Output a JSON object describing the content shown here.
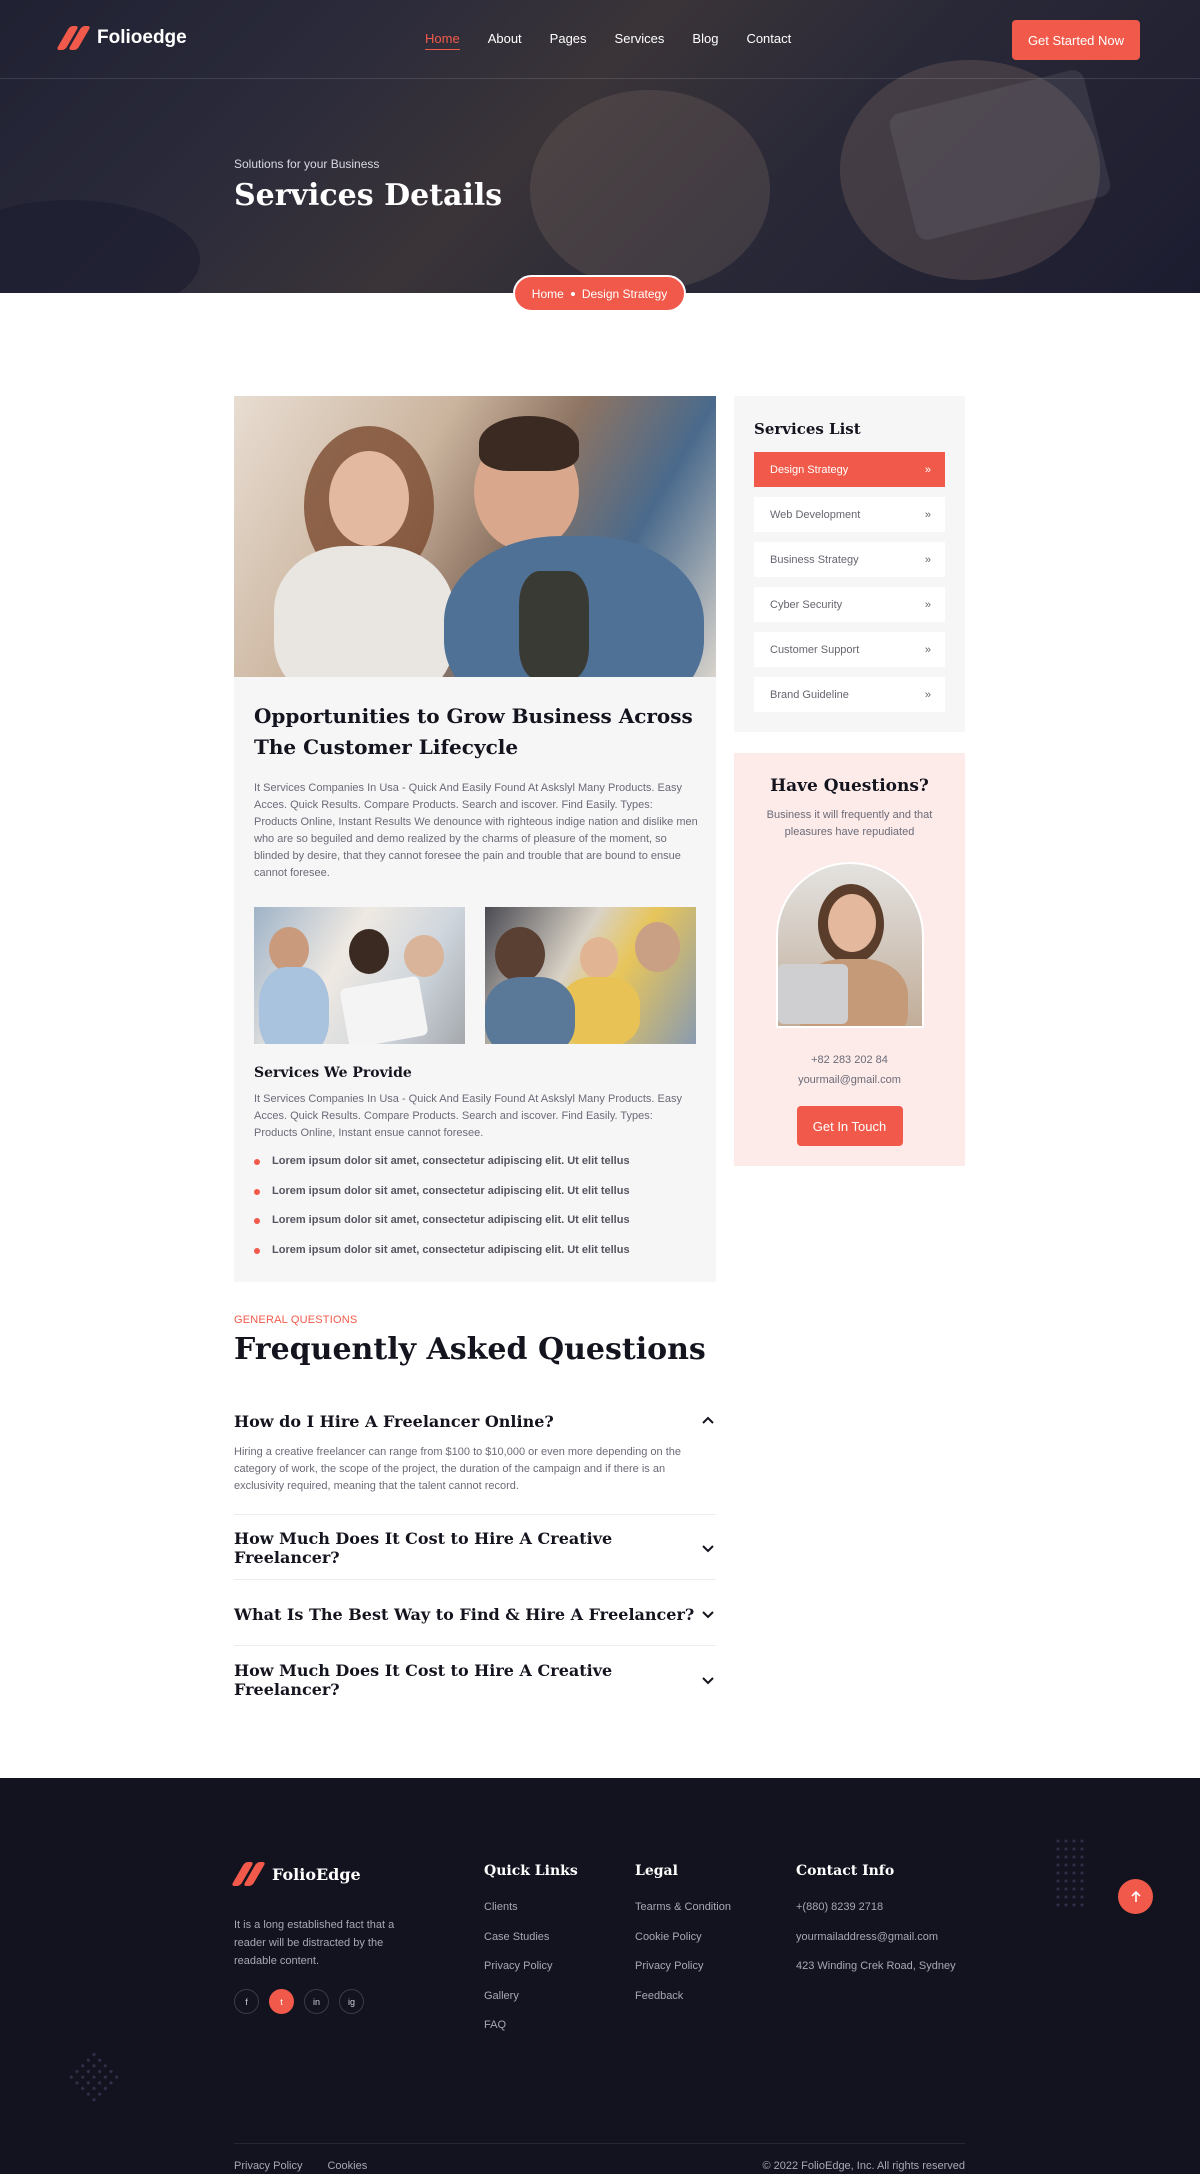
{
  "brand": {
    "name": "Folioedge",
    "footer_name": "FolioEdge",
    "accent": "#f15a4a"
  },
  "nav": {
    "items": [
      "Home",
      "About",
      "Pages",
      "Services",
      "Blog",
      "Contact"
    ],
    "active": "Home",
    "cta": "Get Started Now"
  },
  "hero": {
    "subtitle": "Solutions for your Business",
    "title": "Services Details",
    "breadcrumb": {
      "home": "Home",
      "current": "Design Strategy"
    }
  },
  "article": {
    "title": "Opportunities to Grow Business Across The Customer Lifecycle",
    "intro": "It Services Companies In Usa - Quick And Easily Found At Askslyl Many Products. Easy Acces. Quick Results. Compare Products. Search and iscover. Find Easily. Types: Products Online, Instant Results We denounce with righteous indige nation and dislike men who are so beguiled and demo realized by the charms of pleasure of the moment, so blinded by desire, that they cannot foresee the pain and trouble that are bound to ensue cannot foresee.",
    "services_title": "Services We Provide",
    "services_text": "It Services Companies In Usa - Quick And Easily Found At Askslyl Many Products. Easy Acces. Quick Results. Compare Products. Search and iscover. Find Easily. Types: Products Online, Instant ensue cannot foresee.",
    "bullets": [
      "Lorem ipsum dolor sit amet, consectetur adipiscing elit. Ut elit tellus",
      "Lorem ipsum dolor sit amet, consectetur adipiscing elit. Ut elit tellus",
      "Lorem ipsum dolor sit amet, consectetur adipiscing elit. Ut elit tellus",
      "Lorem ipsum dolor sit amet, consectetur adipiscing elit. Ut elit tellus"
    ]
  },
  "sidebar": {
    "title": "Services List",
    "items": [
      "Design Strategy",
      "Web Development",
      "Business Strategy",
      "Cyber Security",
      "Customer Support",
      "Brand Guideline"
    ],
    "active": "Design Strategy"
  },
  "questions": {
    "title": "Have Questions?",
    "text": "Business it will frequently and that pleasures have repudiated",
    "phone": "+82 283 202 84",
    "email": "yourmail@gmail.com",
    "button": "Get In Touch"
  },
  "faq": {
    "tag": "GENERAL QUESTIONS",
    "title": "Frequently Asked Questions",
    "items": [
      {
        "q": "How do I Hire A Freelancer Online?",
        "a": "Hiring a creative freelancer can range from $100 to $10,000 or even more depending on the category of work, the scope of the project, the duration of the campaign and if there is an exclusivity required, meaning that the talent cannot record.",
        "open": true
      },
      {
        "q": "How Much Does It Cost to Hire A Creative Freelancer?",
        "a": "",
        "open": false
      },
      {
        "q": "What Is The Best Way to Find & Hire A Freelancer?",
        "a": "",
        "open": false
      },
      {
        "q": "How Much Does It Cost to Hire A Creative Freelancer?",
        "a": "",
        "open": false
      }
    ]
  },
  "footer": {
    "about": "It is a long established fact that a reader will be distracted by the readable content.",
    "socials": [
      "f",
      "t",
      "in",
      "ig"
    ],
    "quick_links": {
      "title": "Quick Links",
      "items": [
        "Clients",
        "Case Studies",
        "Privacy Policy",
        "Gallery",
        "FAQ"
      ]
    },
    "legal": {
      "title": "Legal",
      "items": [
        "Tearms & Condition",
        "Cookie Policy",
        "Privacy Policy",
        "Feedback"
      ]
    },
    "contact": {
      "title": "Contact Info",
      "items": [
        "+(880) 8239 2718",
        "yourmailaddress@gmail.com",
        "423 Winding Crek Road, Sydney"
      ]
    },
    "bottom_links": [
      "Privacy Policy",
      "Cookies"
    ],
    "copyright": "© 2022 FolioEdge, Inc. All rights reserved"
  }
}
